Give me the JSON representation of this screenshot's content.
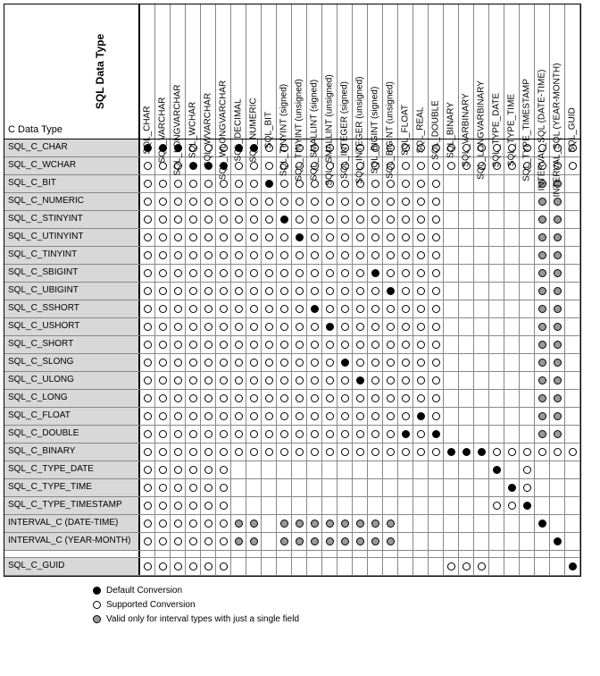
{
  "axis_labels": {
    "rows": "C Data Type",
    "cols": "SQL Data Type"
  },
  "columns": [
    "SQL_CHAR",
    "SQL_VARCHAR",
    "SQL_LONGVARCHAR",
    "SQL_WCHAR",
    "SQL_WVARCHAR",
    "SQL_WLONGVARCHAR",
    "SQL_DECIMAL",
    "SQL_NUMERIC",
    "SQL_BIT",
    "SQL_TINYINT (signed)",
    "SQL_TINYINT (unsigned)",
    "SQL_SMALLINT (signed)",
    "SQL_SMALLINT (unsigned)",
    "SQL_INTEGER (signed)",
    "SQL_INTEGER (unsigned)",
    "SQL_BIGINT (signed)",
    "SQL_BIGINT (unsigned)",
    "SQL_FLOAT",
    "SQL_REAL",
    "SQL_DOUBLE",
    "SQL_BINARY",
    "SQL_VARBINARY",
    "SQL_LONGVARBINARY",
    "SQL_TYPE_DATE",
    "SQL_TYPE_TIME",
    "SQL_TYPE_TIMESTAMP",
    "INTERVAL_SQL (DATE-TIME)",
    "INTERVAL_SQL (YEAR-MONTH)",
    "SQL_GUID"
  ],
  "rows": [
    "SQL_C_CHAR",
    "SQL_C_WCHAR",
    "SQL_C_BIT",
    "SQL_C_NUMERIC",
    "SQL_C_STINYINT",
    "SQL_C_UTINYINT",
    "SQL_C_TINYINT",
    "SQL_C_SBIGINT",
    "SQL_C_UBIGINT",
    "SQL_C_SSHORT",
    "SQL_C_USHORT",
    "SQL_C_SHORT",
    "SQL_C_SLONG",
    "SQL_C_ULONG",
    "SQL_C_LONG",
    "SQL_C_FLOAT",
    "SQL_C_DOUBLE",
    "SQL_C_BINARY",
    "SQL_C_TYPE_DATE",
    "SQL_C_TYPE_TIME",
    "SQL_C_TYPE_TIMESTAMP",
    "INTERVAL_C (DATE-TIME)",
    "INTERVAL_C (YEAR-MONTH)",
    "",
    "SQL_C_GUID"
  ],
  "legend": [
    {
      "key": "D",
      "label": "Default Conversion"
    },
    {
      "key": "S",
      "label": "Supported Conversion"
    },
    {
      "key": "V",
      "label": "Valid only for interval types with just a single field"
    }
  ],
  "chart_data": {
    "type": "heatmap",
    "row_labels": "see rows",
    "col_labels": "see columns",
    "values": [
      [
        "D",
        "D",
        "D",
        "S",
        "S",
        "S",
        "D",
        "D",
        "S",
        "S",
        "S",
        "S",
        "S",
        "S",
        "S",
        "S",
        "S",
        "S",
        "S",
        "S",
        "S",
        "S",
        "S",
        "S",
        "S",
        "S",
        "S",
        "S",
        "S"
      ],
      [
        "S",
        "S",
        "S",
        "D",
        "D",
        "D",
        "S",
        "S",
        "S",
        "S",
        "S",
        "S",
        "S",
        "S",
        "S",
        "S",
        "S",
        "S",
        "S",
        "S",
        "S",
        "S",
        "S",
        "S",
        "S",
        "S",
        "S",
        "S",
        "S"
      ],
      [
        "S",
        "S",
        "S",
        "S",
        "S",
        "S",
        "S",
        "S",
        "D",
        "S",
        "S",
        "S",
        "S",
        "S",
        "S",
        "S",
        "S",
        "S",
        "S",
        "S",
        "",
        "",
        "",
        "",
        "",
        "",
        "V",
        "V",
        ""
      ],
      [
        "S",
        "S",
        "S",
        "S",
        "S",
        "S",
        "S",
        "S",
        "S",
        "S",
        "S",
        "S",
        "S",
        "S",
        "S",
        "S",
        "S",
        "S",
        "S",
        "S",
        "",
        "",
        "",
        "",
        "",
        "",
        "V",
        "V",
        ""
      ],
      [
        "S",
        "S",
        "S",
        "S",
        "S",
        "S",
        "S",
        "S",
        "S",
        "D",
        "S",
        "S",
        "S",
        "S",
        "S",
        "S",
        "S",
        "S",
        "S",
        "S",
        "",
        "",
        "",
        "",
        "",
        "",
        "V",
        "V",
        ""
      ],
      [
        "S",
        "S",
        "S",
        "S",
        "S",
        "S",
        "S",
        "S",
        "S",
        "S",
        "D",
        "S",
        "S",
        "S",
        "S",
        "S",
        "S",
        "S",
        "S",
        "S",
        "",
        "",
        "",
        "",
        "",
        "",
        "V",
        "V",
        ""
      ],
      [
        "S",
        "S",
        "S",
        "S",
        "S",
        "S",
        "S",
        "S",
        "S",
        "S",
        "S",
        "S",
        "S",
        "S",
        "S",
        "S",
        "S",
        "S",
        "S",
        "S",
        "",
        "",
        "",
        "",
        "",
        "",
        "V",
        "V",
        ""
      ],
      [
        "S",
        "S",
        "S",
        "S",
        "S",
        "S",
        "S",
        "S",
        "S",
        "S",
        "S",
        "S",
        "S",
        "S",
        "S",
        "D",
        "S",
        "S",
        "S",
        "S",
        "",
        "",
        "",
        "",
        "",
        "",
        "V",
        "V",
        ""
      ],
      [
        "S",
        "S",
        "S",
        "S",
        "S",
        "S",
        "S",
        "S",
        "S",
        "S",
        "S",
        "S",
        "S",
        "S",
        "S",
        "S",
        "D",
        "S",
        "S",
        "S",
        "",
        "",
        "",
        "",
        "",
        "",
        "V",
        "V",
        ""
      ],
      [
        "S",
        "S",
        "S",
        "S",
        "S",
        "S",
        "S",
        "S",
        "S",
        "S",
        "S",
        "D",
        "S",
        "S",
        "S",
        "S",
        "S",
        "S",
        "S",
        "S",
        "",
        "",
        "",
        "",
        "",
        "",
        "V",
        "V",
        ""
      ],
      [
        "S",
        "S",
        "S",
        "S",
        "S",
        "S",
        "S",
        "S",
        "S",
        "S",
        "S",
        "S",
        "D",
        "S",
        "S",
        "S",
        "S",
        "S",
        "S",
        "S",
        "",
        "",
        "",
        "",
        "",
        "",
        "V",
        "V",
        ""
      ],
      [
        "S",
        "S",
        "S",
        "S",
        "S",
        "S",
        "S",
        "S",
        "S",
        "S",
        "S",
        "S",
        "S",
        "S",
        "S",
        "S",
        "S",
        "S",
        "S",
        "S",
        "",
        "",
        "",
        "",
        "",
        "",
        "V",
        "V",
        ""
      ],
      [
        "S",
        "S",
        "S",
        "S",
        "S",
        "S",
        "S",
        "S",
        "S",
        "S",
        "S",
        "S",
        "S",
        "D",
        "S",
        "S",
        "S",
        "S",
        "S",
        "S",
        "",
        "",
        "",
        "",
        "",
        "",
        "V",
        "V",
        ""
      ],
      [
        "S",
        "S",
        "S",
        "S",
        "S",
        "S",
        "S",
        "S",
        "S",
        "S",
        "S",
        "S",
        "S",
        "S",
        "D",
        "S",
        "S",
        "S",
        "S",
        "S",
        "",
        "",
        "",
        "",
        "",
        "",
        "V",
        "V",
        ""
      ],
      [
        "S",
        "S",
        "S",
        "S",
        "S",
        "S",
        "S",
        "S",
        "S",
        "S",
        "S",
        "S",
        "S",
        "S",
        "S",
        "S",
        "S",
        "S",
        "S",
        "S",
        "",
        "",
        "",
        "",
        "",
        "",
        "V",
        "V",
        ""
      ],
      [
        "S",
        "S",
        "S",
        "S",
        "S",
        "S",
        "S",
        "S",
        "S",
        "S",
        "S",
        "S",
        "S",
        "S",
        "S",
        "S",
        "S",
        "S",
        "D",
        "S",
        "",
        "",
        "",
        "",
        "",
        "",
        "V",
        "V",
        ""
      ],
      [
        "S",
        "S",
        "S",
        "S",
        "S",
        "S",
        "S",
        "S",
        "S",
        "S",
        "S",
        "S",
        "S",
        "S",
        "S",
        "S",
        "S",
        "D",
        "S",
        "D",
        "",
        "",
        "",
        "",
        "",
        "",
        "V",
        "V",
        ""
      ],
      [
        "S",
        "S",
        "S",
        "S",
        "S",
        "S",
        "S",
        "S",
        "S",
        "S",
        "S",
        "S",
        "S",
        "S",
        "S",
        "S",
        "S",
        "S",
        "S",
        "S",
        "D",
        "D",
        "D",
        "S",
        "S",
        "S",
        "S",
        "S",
        "S"
      ],
      [
        "S",
        "S",
        "S",
        "S",
        "S",
        "S",
        "",
        "",
        "",
        "",
        "",
        "",
        "",
        "",
        "",
        "",
        "",
        "",
        "",
        "",
        "",
        "",
        "",
        "D",
        "",
        "S",
        "",
        "",
        ""
      ],
      [
        "S",
        "S",
        "S",
        "S",
        "S",
        "S",
        "",
        "",
        "",
        "",
        "",
        "",
        "",
        "",
        "",
        "",
        "",
        "",
        "",
        "",
        "",
        "",
        "",
        "",
        "D",
        "S",
        "",
        "",
        ""
      ],
      [
        "S",
        "S",
        "S",
        "S",
        "S",
        "S",
        "",
        "",
        "",
        "",
        "",
        "",
        "",
        "",
        "",
        "",
        "",
        "",
        "",
        "",
        "",
        "",
        "",
        "S",
        "S",
        "D",
        "",
        "",
        ""
      ],
      [
        "S",
        "S",
        "S",
        "S",
        "S",
        "S",
        "V",
        "V",
        "",
        "V",
        "V",
        "V",
        "V",
        "V",
        "V",
        "V",
        "V",
        "",
        "",
        "",
        "",
        "",
        "",
        "",
        "",
        "",
        "D",
        "",
        ""
      ],
      [
        "S",
        "S",
        "S",
        "S",
        "S",
        "S",
        "V",
        "V",
        "",
        "V",
        "V",
        "V",
        "V",
        "V",
        "V",
        "V",
        "V",
        "",
        "",
        "",
        "",
        "",
        "",
        "",
        "",
        "",
        "",
        "D",
        ""
      ],
      [
        "",
        "",
        "",
        "",
        "",
        "",
        "",
        "",
        "",
        "",
        "",
        "",
        "",
        "",
        "",
        "",
        "",
        "",
        "",
        "",
        "",
        "",
        "",
        "",
        "",
        "",
        "",
        "",
        ""
      ],
      [
        "S",
        "S",
        "S",
        "S",
        "S",
        "S",
        "",
        "",
        "",
        "",
        "",
        "",
        "",
        "",
        "",
        "",
        "",
        "",
        "",
        "",
        "S",
        "S",
        "S",
        "",
        "",
        "",
        "",
        "",
        "D"
      ]
    ],
    "legend": {
      "D": "Default Conversion",
      "S": "Supported Conversion",
      "V": "Valid only for interval types with just a single field",
      "": "blank"
    }
  }
}
